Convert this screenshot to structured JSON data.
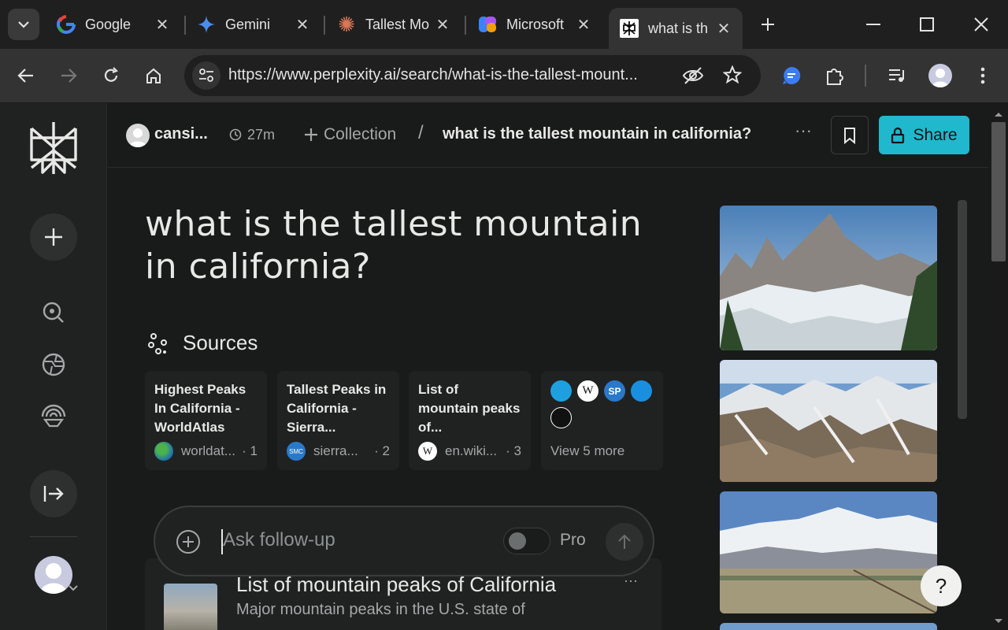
{
  "browser": {
    "tabs": [
      {
        "title": "Google",
        "icon": "google-g-icon"
      },
      {
        "title": "Gemini",
        "icon": "gemini-sparkle-icon"
      },
      {
        "title": "Tallest Mo",
        "icon": "claude-asterisk-icon"
      },
      {
        "title": "Microsoft",
        "icon": "copilot-icon"
      },
      {
        "title": "what is th",
        "icon": "perplexity-icon",
        "active": true
      }
    ],
    "url": "https://www.perplexity.ai/search/what-is-the-tallest-mount..."
  },
  "header": {
    "user": "cansi...",
    "time": "27m",
    "collection": "Collection",
    "separator": "/",
    "thread_title": "what is the tallest mountain in california?",
    "more": "···",
    "share_label": "Share"
  },
  "main": {
    "question": "what is the tallest mountain in california?",
    "sources_heading": "Sources",
    "sources": [
      {
        "title": "Highest Peaks In California - WorldAtlas",
        "site": "worldat...",
        "index": "· 1",
        "icon_color": "#2b8a3e"
      },
      {
        "title": "Tallest Peaks in California - Sierra...",
        "site": "sierra...",
        "index": "· 2",
        "icon_color": "#e0a030"
      },
      {
        "title": "List of mountain peaks of...",
        "site": "en.wiki...",
        "index": "· 3",
        "icon_color": "#ffffff"
      }
    ],
    "more_sources": "View 5 more",
    "followup_placeholder": "Ask follow-up",
    "pro_label": "Pro",
    "result_title": "List of mountain peaks of California",
    "result_snippet": "Major mountain peaks in the U.S. state of",
    "result_more": "···",
    "help": "?"
  },
  "colors": {
    "accent": "#20b8cd",
    "background": "#191a1a",
    "card": "#202222"
  }
}
